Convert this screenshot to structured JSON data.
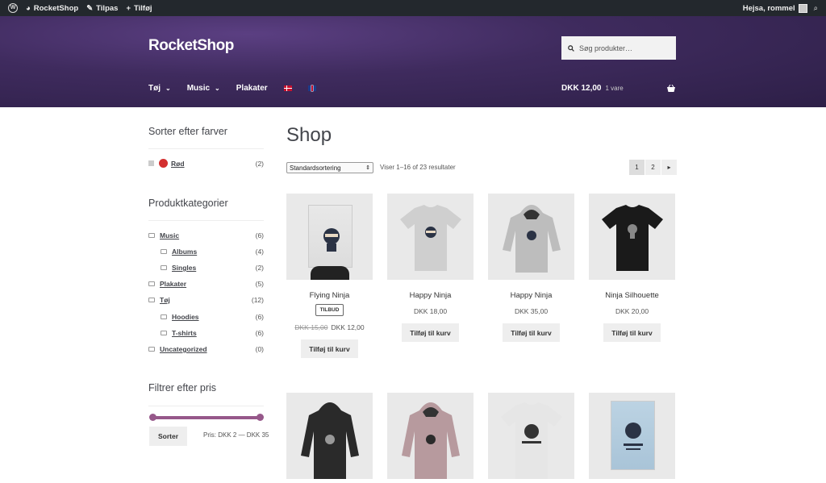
{
  "adminbar": {
    "site": "RocketShop",
    "customize": "Tilpas",
    "add": "Tilføj",
    "greeting": "Hejsa, rommel"
  },
  "header": {
    "title": "RocketShop",
    "search_placeholder": "Søg produkter…",
    "nav": [
      "Tøj",
      "Music",
      "Plakater"
    ],
    "cart_total": "DKK 12,00",
    "cart_count": "1 vare"
  },
  "sidebar": {
    "color_filter": {
      "title": "Sorter efter farver",
      "items": [
        {
          "label": "Rød",
          "count": "(2)"
        }
      ]
    },
    "categories": {
      "title": "Produktkategorier",
      "items": [
        {
          "label": "Music",
          "count": "(6)"
        },
        {
          "label": "Albums",
          "count": "(4)"
        },
        {
          "label": "Singles",
          "count": "(2)"
        },
        {
          "label": "Plakater",
          "count": "(5)"
        },
        {
          "label": "Tøj",
          "count": "(12)"
        },
        {
          "label": "Hoodies",
          "count": "(6)"
        },
        {
          "label": "T-shirts",
          "count": "(6)"
        },
        {
          "label": "Uncategorized",
          "count": "(0)"
        }
      ]
    },
    "price_filter": {
      "title": "Filtrer efter pris",
      "button": "Sorter",
      "range_label": "Pris: DKK 2 — DKK 35"
    }
  },
  "main": {
    "title": "Shop",
    "sort_selected": "Standardsortering",
    "result_count": "Viser 1–16 of 23 resultater",
    "pages": [
      "1",
      "2"
    ],
    "products": [
      {
        "name": "Flying Ninja",
        "badge": "TILBUD",
        "old_price": "DKK 15,00",
        "price": "DKK 12,00",
        "button": "Tilføj til kurv"
      },
      {
        "name": "Happy Ninja",
        "price": "DKK 18,00",
        "button": "Tilføj til kurv"
      },
      {
        "name": "Happy Ninja",
        "price": "DKK 35,00",
        "button": "Tilføj til kurv"
      },
      {
        "name": "Ninja Silhouette",
        "price": "DKK 20,00",
        "button": "Tilføj til kurv"
      }
    ]
  },
  "colors": {
    "accent": "#96588a",
    "header_bg": "#3f2b5e",
    "adminbar_bg": "#23282d",
    "swatch_red": "#d32f2f"
  },
  "icons": [
    "wordpress-icon",
    "dashboard-icon",
    "brush-icon",
    "plus-icon",
    "search-icon",
    "basket-icon",
    "chevron-down-icon",
    "folder-icon",
    "flag-dk-icon",
    "flag-gb-icon",
    "next-page-icon"
  ]
}
